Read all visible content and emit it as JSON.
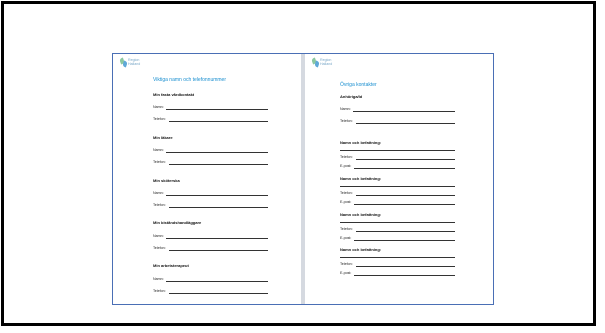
{
  "logo": {
    "line1": "Region",
    "line2": "Halland"
  },
  "left": {
    "title": "Viktiga namn och telefonnummer",
    "sections": [
      {
        "heading": "Min fasta vårdkontakt",
        "fields": [
          "Namn:",
          "Telefon:"
        ]
      },
      {
        "heading": "Min läkare",
        "fields": [
          "Namn:",
          "Telefon:"
        ]
      },
      {
        "heading": "Min sköterska",
        "fields": [
          "Namn:",
          "Telefon:"
        ]
      },
      {
        "heading": "Min biståndshandläggare",
        "fields": [
          "Namn:",
          "Telefon:"
        ]
      },
      {
        "heading": "Min arbetsterapeut",
        "fields": [
          "Namn:",
          "Telefon:"
        ]
      }
    ]
  },
  "right": {
    "title": "Övriga kontakter",
    "first": {
      "heading": "Anhöriga/Id",
      "fields": [
        "Namn:",
        "Telefon:"
      ]
    },
    "contacts": [
      {
        "heading": "Namn och befattning:",
        "fields": [
          "Telefon:",
          "E-post:"
        ]
      },
      {
        "heading": "Namn och befattning:",
        "fields": [
          "Telefon:",
          "E-post:"
        ]
      },
      {
        "heading": "Namn och befattning:",
        "fields": [
          "Telefon:",
          "E-post:"
        ]
      },
      {
        "heading": "Namn och befattning:",
        "fields": [
          "Telefon:",
          "E-post:"
        ]
      }
    ]
  }
}
